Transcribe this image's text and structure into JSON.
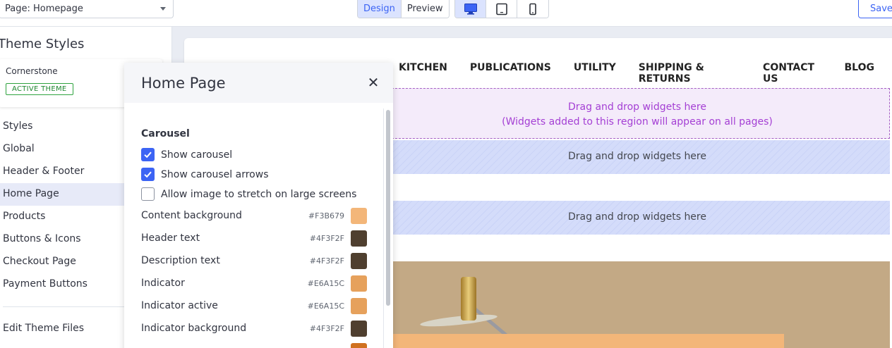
{
  "toolbar": {
    "page_select": "Page: Homepage",
    "mode_design": "Design",
    "mode_preview": "Preview",
    "save_label": "Save",
    "devices": [
      "desktop-icon",
      "tablet-icon",
      "mobile-icon"
    ],
    "active_device": "desktop",
    "accent_color": "#3C64F4"
  },
  "sidebar": {
    "title": "Theme Styles",
    "theme_name": "Cornerstone",
    "theme_badge": "ACTIVE THEME",
    "items": [
      {
        "label": "Styles"
      },
      {
        "label": "Global"
      },
      {
        "label": "Header & Footer"
      },
      {
        "label": "Home Page"
      },
      {
        "label": "Products"
      },
      {
        "label": "Buttons & Icons"
      },
      {
        "label": "Checkout Page"
      },
      {
        "label": "Payment Buttons"
      }
    ],
    "active_item": "Home Page",
    "bottom_item": "Edit Theme Files"
  },
  "preview": {
    "nav_items": [
      "KITCHEN",
      "PUBLICATIONS",
      "UTILITY",
      "SHIPPING & RETURNS",
      "CONTACT US",
      "BLOG"
    ],
    "global_region_line1": "Drag and drop widgets here",
    "global_region_line2": "(Widgets added to this region will appear on all pages)",
    "region1": "Drag and drop widgets here",
    "region2": "Drag and drop widgets here"
  },
  "panel": {
    "title": "Home Page",
    "close_icon": "close-icon",
    "section": "Carousel",
    "checkboxes": [
      {
        "label": "Show carousel",
        "checked": true
      },
      {
        "label": "Show carousel arrows",
        "checked": true
      },
      {
        "label": "Allow image to stretch on large screens",
        "checked": false
      }
    ],
    "colors": [
      {
        "label": "Content background",
        "hex": "#F3B679",
        "swatch": "#F3B679"
      },
      {
        "label": "Header text",
        "hex": "#4F3F2F",
        "swatch": "#4F3F2F"
      },
      {
        "label": "Description text",
        "hex": "#4F3F2F",
        "swatch": "#4F3F2F"
      },
      {
        "label": "Indicator",
        "hex": "#E6A15C",
        "swatch": "#E6A15C"
      },
      {
        "label": "Indicator active",
        "hex": "#E6A15C",
        "swatch": "#E6A15C"
      },
      {
        "label": "Indicator background",
        "hex": "#4F3F2F",
        "swatch": "#4F3F2F"
      }
    ]
  }
}
